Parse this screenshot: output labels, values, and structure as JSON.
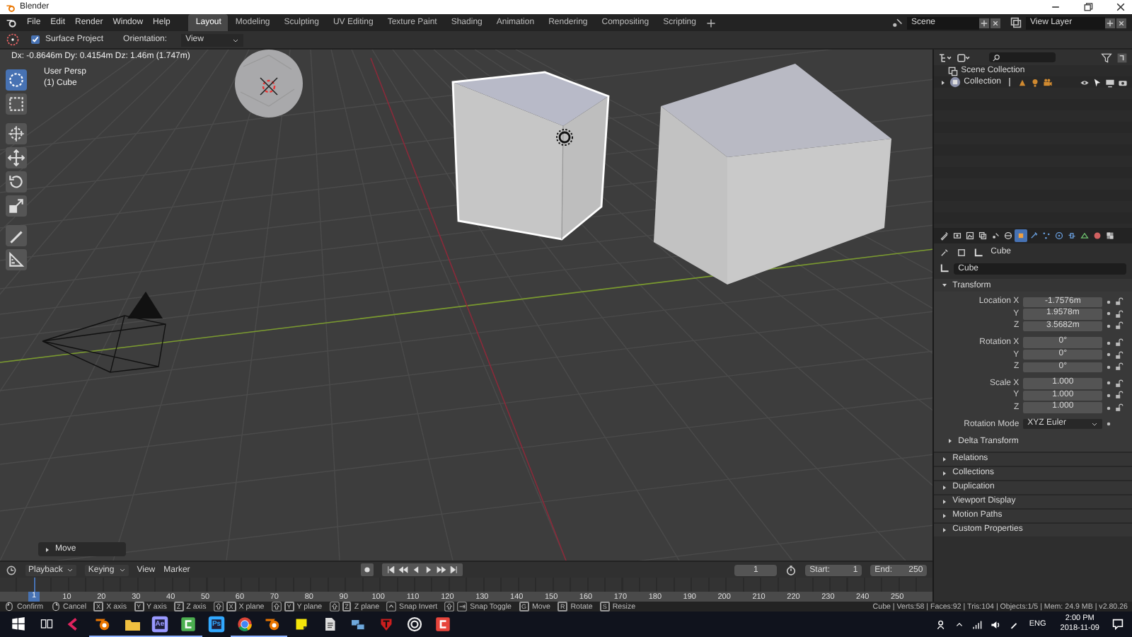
{
  "window": {
    "title": "Blender"
  },
  "menu": [
    "File",
    "Edit",
    "Render",
    "Window",
    "Help"
  ],
  "workspace_tabs": [
    {
      "label": "Layout",
      "selected": true
    },
    {
      "label": "Modeling",
      "selected": false
    },
    {
      "label": "Sculpting",
      "selected": false
    },
    {
      "label": "UV Editing",
      "selected": false
    },
    {
      "label": "Texture Paint",
      "selected": false
    },
    {
      "label": "Shading",
      "selected": false
    },
    {
      "label": "Animation",
      "selected": false
    },
    {
      "label": "Rendering",
      "selected": false
    },
    {
      "label": "Compositing",
      "selected": false
    },
    {
      "label": "Scripting",
      "selected": false
    }
  ],
  "scene": {
    "value": "Scene"
  },
  "view_layer": {
    "value": "View Layer"
  },
  "tool_header": {
    "surface_project": {
      "label": "Surface Project",
      "checked": true
    },
    "orientation": {
      "label": "Orientation:",
      "value": "View"
    }
  },
  "viewport": {
    "readout": "Dx: -0.8646m  Dy: 0.4154m  Dz: 1.46m (1.747m)",
    "view_name": "User Persp",
    "object": "(1) Cube",
    "tools": [
      {
        "kind": "select-circle",
        "selected": true
      },
      {
        "kind": "select-box",
        "selected": false
      },
      {
        "kind": "cursor",
        "selected": false
      },
      {
        "kind": "move",
        "selected": false
      },
      {
        "kind": "rotate",
        "selected": false
      },
      {
        "kind": "scale",
        "selected": false
      },
      {
        "kind": "annotate",
        "selected": false
      },
      {
        "kind": "measure",
        "selected": false
      }
    ],
    "operator_panel": {
      "label": "Move",
      "expanded": false
    }
  },
  "outliner": {
    "rows": [
      {
        "kind": "scene",
        "label": "Scene Collection"
      },
      {
        "kind": "collection",
        "label": "Collection",
        "expanded": false
      }
    ]
  },
  "properties": {
    "tabs": [
      {
        "kind": "tool",
        "selected": false
      },
      {
        "kind": "render",
        "selected": false
      },
      {
        "kind": "output",
        "selected": false
      },
      {
        "kind": "layers",
        "selected": false
      },
      {
        "kind": "scene",
        "selected": false
      },
      {
        "kind": "world",
        "selected": false
      },
      {
        "kind": "object",
        "selected": true
      },
      {
        "kind": "modifier",
        "selected": false
      },
      {
        "kind": "particles",
        "selected": false
      },
      {
        "kind": "physics",
        "selected": false
      },
      {
        "kind": "constraint",
        "selected": false
      },
      {
        "kind": "data",
        "selected": false
      },
      {
        "kind": "material",
        "selected": false
      },
      {
        "kind": "texture",
        "selected": false
      }
    ],
    "breadcrumb": "Cube",
    "name": "Cube",
    "transform": {
      "label": "Transform",
      "expanded": true,
      "groups": [
        {
          "rows": [
            {
              "label": "Location X",
              "value": "-1.7576m"
            },
            {
              "label": "Y",
              "value": "1.9578m"
            },
            {
              "label": "Z",
              "value": "3.5682m"
            }
          ]
        },
        {
          "rows": [
            {
              "label": "Rotation X",
              "value": "0°"
            },
            {
              "label": "Y",
              "value": "0°"
            },
            {
              "label": "Z",
              "value": "0°"
            }
          ]
        },
        {
          "rows": [
            {
              "label": "Scale X",
              "value": "1.000"
            },
            {
              "label": "Y",
              "value": "1.000"
            },
            {
              "label": "Z",
              "value": "1.000"
            }
          ]
        }
      ],
      "rotation_mode": {
        "label": "Rotation Mode",
        "value": "XYZ Euler"
      },
      "subpanel": {
        "label": "Delta Transform",
        "expanded": false
      }
    },
    "panels": [
      {
        "label": "Relations",
        "expanded": false
      },
      {
        "label": "Collections",
        "expanded": false
      },
      {
        "label": "Duplication",
        "expanded": false
      },
      {
        "label": "Viewport Display",
        "expanded": false
      },
      {
        "label": "Motion Paths",
        "expanded": false
      },
      {
        "label": "Custom Properties",
        "expanded": false
      }
    ]
  },
  "timeline": {
    "menus": [
      {
        "label": "Playback",
        "kind": "dropdown"
      },
      {
        "label": "Keying",
        "kind": "dropdown"
      },
      {
        "label": "View",
        "kind": "plain"
      },
      {
        "label": "Marker",
        "kind": "plain"
      }
    ],
    "current_frame": "1",
    "start": {
      "label": "Start:",
      "value": "1"
    },
    "end": {
      "label": "End:",
      "value": "250"
    },
    "playhead": "1",
    "ticks": [
      "10",
      "20",
      "30",
      "40",
      "50",
      "60",
      "70",
      "80",
      "90",
      "100",
      "110",
      "120",
      "130",
      "140",
      "150",
      "160",
      "170",
      "180",
      "190",
      "200",
      "210",
      "220",
      "230",
      "240",
      "250"
    ]
  },
  "status_bar": {
    "hints": [
      {
        "keys": [
          {
            "kind": "mouse-left"
          }
        ],
        "label": "Confirm"
      },
      {
        "keys": [
          {
            "kind": "mouse-right"
          }
        ],
        "label": "Cancel"
      },
      {
        "keys": [
          {
            "kind": "key",
            "text": "X"
          }
        ],
        "label": "X axis"
      },
      {
        "keys": [
          {
            "kind": "key",
            "text": "Y"
          }
        ],
        "label": "Y axis"
      },
      {
        "keys": [
          {
            "kind": "key",
            "text": "Z"
          }
        ],
        "label": "Z axis"
      },
      {
        "keys": [
          {
            "kind": "shift"
          },
          {
            "kind": "key",
            "text": "X"
          }
        ],
        "label": "X plane"
      },
      {
        "keys": [
          {
            "kind": "shift"
          },
          {
            "kind": "key",
            "text": "Y"
          }
        ],
        "label": "Y plane"
      },
      {
        "keys": [
          {
            "kind": "shift"
          },
          {
            "kind": "key",
            "text": "Z"
          }
        ],
        "label": "Z plane"
      },
      {
        "keys": [
          {
            "kind": "ctrl"
          }
        ],
        "label": "Snap Invert"
      },
      {
        "keys": [
          {
            "kind": "shift"
          },
          {
            "kind": "tab"
          }
        ],
        "label": "Snap Toggle"
      },
      {
        "keys": [
          {
            "kind": "key",
            "text": "G"
          }
        ],
        "label": "Move"
      },
      {
        "keys": [
          {
            "kind": "key",
            "text": "R"
          }
        ],
        "label": "Rotate"
      },
      {
        "keys": [
          {
            "kind": "key",
            "text": "S"
          }
        ],
        "label": "Resize"
      }
    ],
    "stats": "Cube | Verts:58 | Faces:92 | Tris:104 | Objects:1/5 | Mem: 24.9 MB | v2.80.26"
  },
  "taskbar": {
    "apps": [
      {
        "kind": "chevron",
        "color": "#e0245e",
        "running": false
      },
      {
        "kind": "blender",
        "color": "#ea7600",
        "running": true
      },
      {
        "kind": "folder",
        "color": "#f0c040",
        "running": true
      },
      {
        "kind": "letters",
        "label": "Ae",
        "color": "#9999ff",
        "running": true
      },
      {
        "kind": "bracket",
        "color": "#4caf50",
        "running": true
      },
      {
        "kind": "letters",
        "label": "Ps",
        "color": "#31a8ff",
        "running": false
      },
      {
        "kind": "chrome",
        "color": "#db4437",
        "running": true
      },
      {
        "kind": "blender",
        "color": "#ea7600",
        "running": true
      },
      {
        "kind": "note",
        "color": "#f5e50a",
        "running": false
      },
      {
        "kind": "paper",
        "color": "#dddddd",
        "running": false
      },
      {
        "kind": "network",
        "color": "#6fa8dc",
        "running": false
      },
      {
        "kind": "shield",
        "color": "#cc1e1e",
        "running": false
      },
      {
        "kind": "target",
        "color": "#eeeeee",
        "running": false
      },
      {
        "kind": "bracket",
        "color": "#e8453c",
        "running": false
      }
    ],
    "language": "ENG",
    "time": "2:00 PM",
    "date": "2018-11-09"
  }
}
